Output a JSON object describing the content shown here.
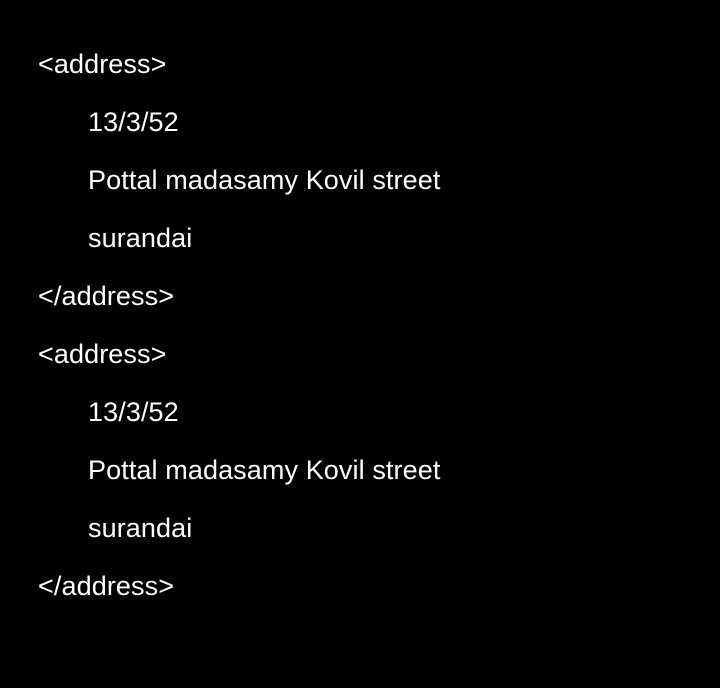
{
  "blocks": [
    {
      "open_tag": "<address>",
      "lines": [
        "13/3/52",
        "Pottal madasamy Kovil street",
        "surandai"
      ],
      "close_tag": "</address>"
    },
    {
      "open_tag": "<address>",
      "lines": [
        "13/3/52",
        "Pottal madasamy Kovil street",
        "surandai"
      ],
      "close_tag": "</address>"
    }
  ],
  "colors": {
    "background": "#000000",
    "text": "#ffffff"
  }
}
